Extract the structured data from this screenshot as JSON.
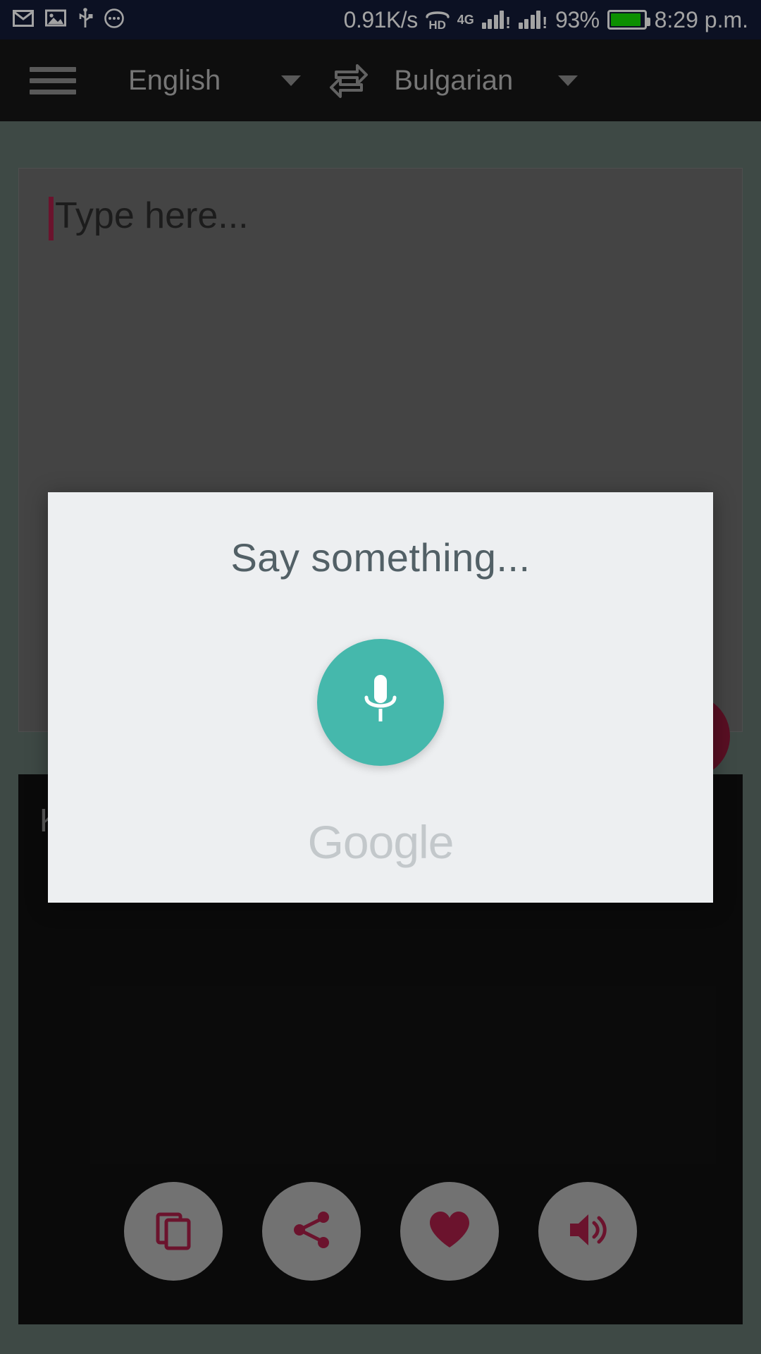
{
  "status_bar": {
    "background": "#141c38",
    "left_icons": [
      {
        "name": "email-icon",
        "glyph": "envelope"
      },
      {
        "name": "image-icon",
        "glyph": "picture"
      },
      {
        "name": "usb-icon",
        "glyph": "usb"
      },
      {
        "name": "more-notifications-icon",
        "glyph": "ellipsis-circle"
      }
    ],
    "network_speed": "0.91K/s",
    "hd_call_label": "HD",
    "network_type": "4G",
    "sim1_warning": "!",
    "sim2_warning": "!",
    "battery_percent": "93%",
    "battery_level": 93,
    "battery_color": "#14e000",
    "time": "8:29 p.m."
  },
  "toolbar": {
    "background": "#161616",
    "menu_icon": "hamburger-menu-icon",
    "source_language": "English",
    "target_language": "Bulgarian",
    "swap_icon": "swap-languages-icon",
    "dropdown_icon": "chevron-down-icon"
  },
  "input_card": {
    "placeholder": "Type here...",
    "value": "",
    "cursor_color": "#a81f47",
    "background": "#6b6b6b"
  },
  "fab": {
    "name": "voice-input-fab",
    "color": "#8c1838"
  },
  "result_panel": {
    "background": "#111111",
    "translated_text": "K",
    "actions": [
      {
        "name": "copy-button",
        "icon": "copy-icon",
        "label": "Copy"
      },
      {
        "name": "share-button",
        "icon": "share-icon",
        "label": "Share"
      },
      {
        "name": "favorite-button",
        "icon": "heart-icon",
        "label": "Favorite"
      },
      {
        "name": "speak-button",
        "icon": "speaker-icon",
        "label": "Speak"
      }
    ],
    "action_icon_color": "#a81f47",
    "action_bg_color": "#b3b3b3"
  },
  "voice_dialog": {
    "title": "Say something...",
    "title_color": "#526066",
    "background": "#edeff1",
    "mic_button": {
      "name": "microphone-button",
      "icon": "microphone-icon",
      "color": "#45b8ac"
    },
    "brand": "Google",
    "brand_color": "#c3c8cb"
  }
}
